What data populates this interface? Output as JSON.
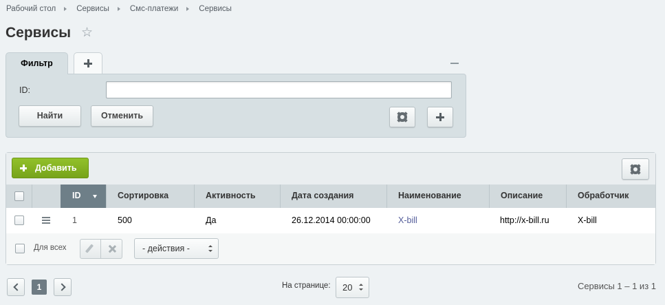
{
  "breadcrumb": [
    "Рабочий стол",
    "Сервисы",
    "Смс-платежи",
    "Сервисы"
  ],
  "page_title": "Сервисы",
  "filter": {
    "tab_label": "Фильтр",
    "id_label": "ID:",
    "id_value": "",
    "find_label": "Найти",
    "cancel_label": "Отменить"
  },
  "grid": {
    "add_label": "Добавить",
    "columns": [
      "ID",
      "Сортировка",
      "Активность",
      "Дата создания",
      "Наименование",
      "Описание",
      "Обработчик"
    ],
    "sorted_column": "ID",
    "rows": [
      {
        "id": "1",
        "sort": "500",
        "active": "Да",
        "created": "26.12.2014 00:00:00",
        "name": "X-bill",
        "description": "http://x-bill.ru",
        "handler": "X-bill"
      }
    ],
    "for_all_label": "Для всех",
    "actions_value": "- действия -"
  },
  "pagination": {
    "current_page": "1",
    "per_page_label": "На странице:",
    "per_page_value": "20",
    "count_text": "Сервисы 1 – 1 из 1"
  },
  "colors": {
    "add_button": "#80ad1f",
    "sorted_header": "#6e7f88",
    "panel": "#d7e0e3"
  }
}
